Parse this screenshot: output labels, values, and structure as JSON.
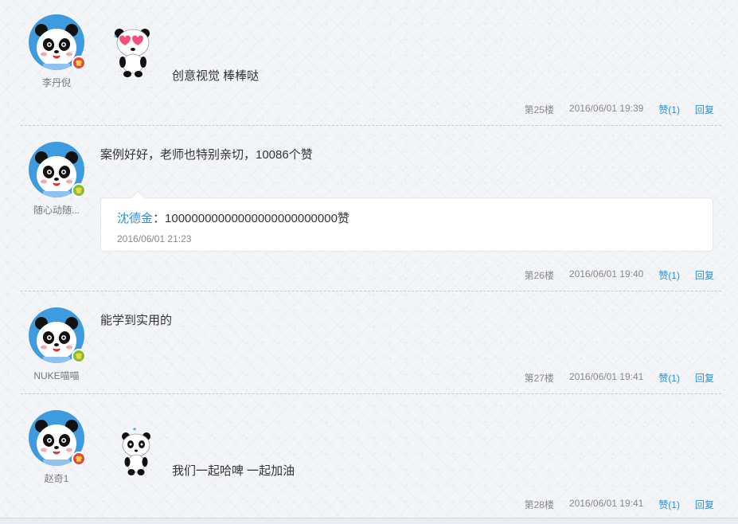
{
  "posts": [
    {
      "username": "李丹倪",
      "text": "创意视觉  棒棒哒",
      "floor": "第25楼",
      "time": "2016/06/01 19:39",
      "like": "赞(1)",
      "reply": "回复",
      "badge_color": "#e8453c",
      "sticker": "heart-eyes-panda-icon"
    },
    {
      "username": "随心动随...",
      "text": "案例好好，老师也特别亲切，10086个赞",
      "floor": "第26楼",
      "time": "2016/06/01 19:40",
      "like": "赞(1)",
      "reply": "回复",
      "badge_color": "#7cc22e",
      "replies": [
        {
          "author": "沈德金",
          "separator": "：",
          "text": "10000000000000000000000000赞",
          "time": "2016/06/01 21:23"
        }
      ]
    },
    {
      "username": "NUKE喵喵",
      "text": "能学到实用的",
      "floor": "第27楼",
      "time": "2016/06/01 19:41",
      "like": "赞(1)",
      "reply": "回复",
      "badge_color": "#7cc22e"
    },
    {
      "username": "赵奇1",
      "text": "我们一起哈啤   一起加油",
      "floor": "第28楼",
      "time": "2016/06/01 19:41",
      "like": "赞(1)",
      "reply": "回复",
      "badge_color": "#e8453c",
      "sticker": "sweating-panda-icon"
    }
  ],
  "colors": {
    "link": "#2b8fd9",
    "avatar_bg": "#3f9be0",
    "meta_text": "#888888"
  }
}
